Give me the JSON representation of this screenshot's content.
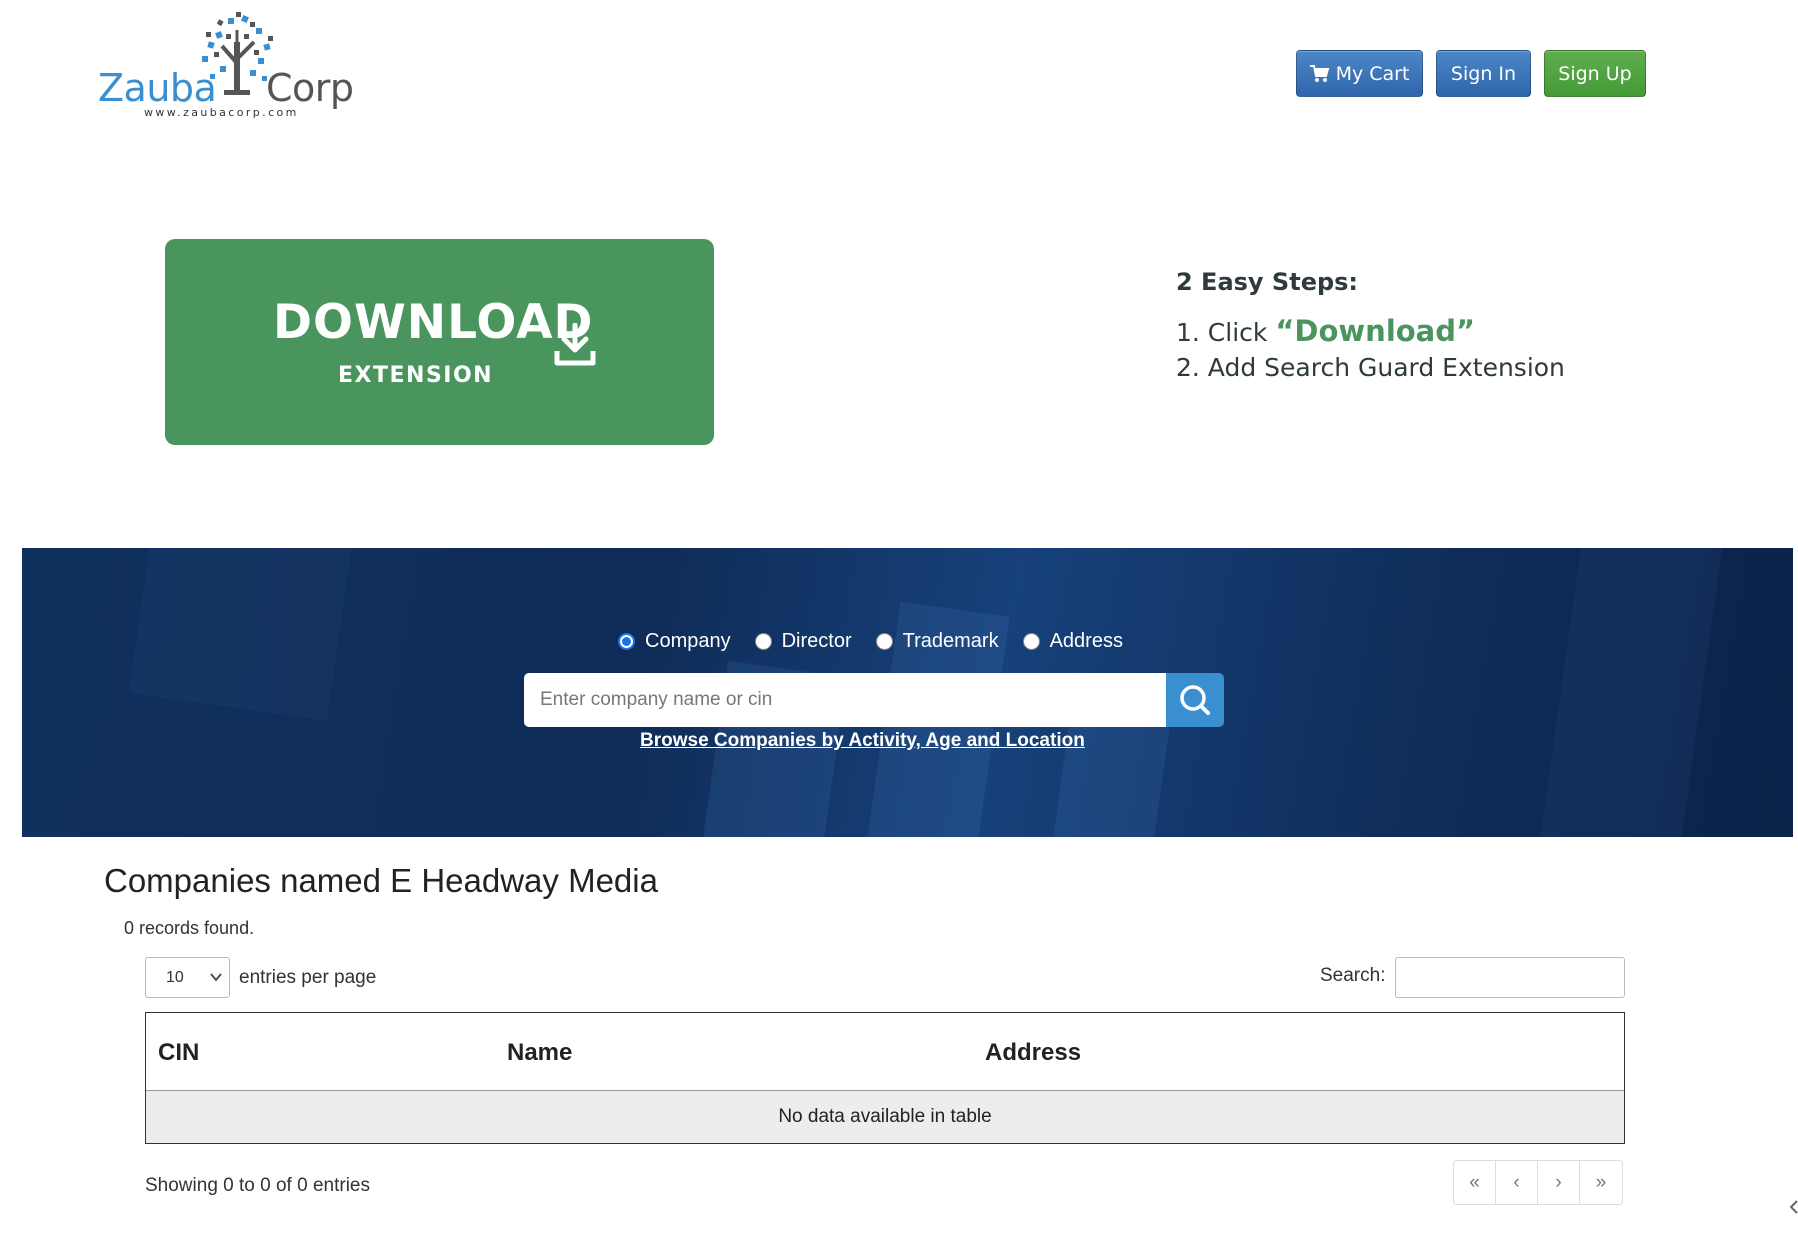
{
  "header": {
    "logo": {
      "brand_left": "Zauba",
      "brand_right": "Corp",
      "url": "www.zaubacorp.com"
    },
    "buttons": {
      "cart": "My Cart",
      "signin": "Sign In",
      "signup": "Sign Up"
    },
    "icons": {
      "cart": "shopping-cart-icon"
    }
  },
  "promo": {
    "title": "DOWNLOAD",
    "subtitle": "EXTENSION",
    "icon": "download-icon",
    "color": "#4a955e",
    "steps_title": "2 Easy Steps:",
    "step1_prefix": "1. Click ",
    "step1_highlight": "“Download”",
    "step2": "2. Add Search Guard Extension"
  },
  "search": {
    "options": [
      {
        "label": "Company",
        "checked": true
      },
      {
        "label": "Director",
        "checked": false
      },
      {
        "label": "Trademark",
        "checked": false
      },
      {
        "label": "Address",
        "checked": false
      }
    ],
    "placeholder": "Enter company name or cin",
    "browse_link": "Browse Companies by Activity, Age and Location",
    "accent": "#3a8fd0"
  },
  "results": {
    "title": "Companies named E Headway Media",
    "records": "0 records found.",
    "per_page_value": "10",
    "per_page_label": "entries per page",
    "search_label": "Search:",
    "columns": [
      "CIN",
      "Name",
      "Address"
    ],
    "empty_message": "No data available in table",
    "showing": "Showing 0 to 0 of 0 entries",
    "pager": [
      "«",
      "‹",
      "›",
      "»"
    ]
  }
}
